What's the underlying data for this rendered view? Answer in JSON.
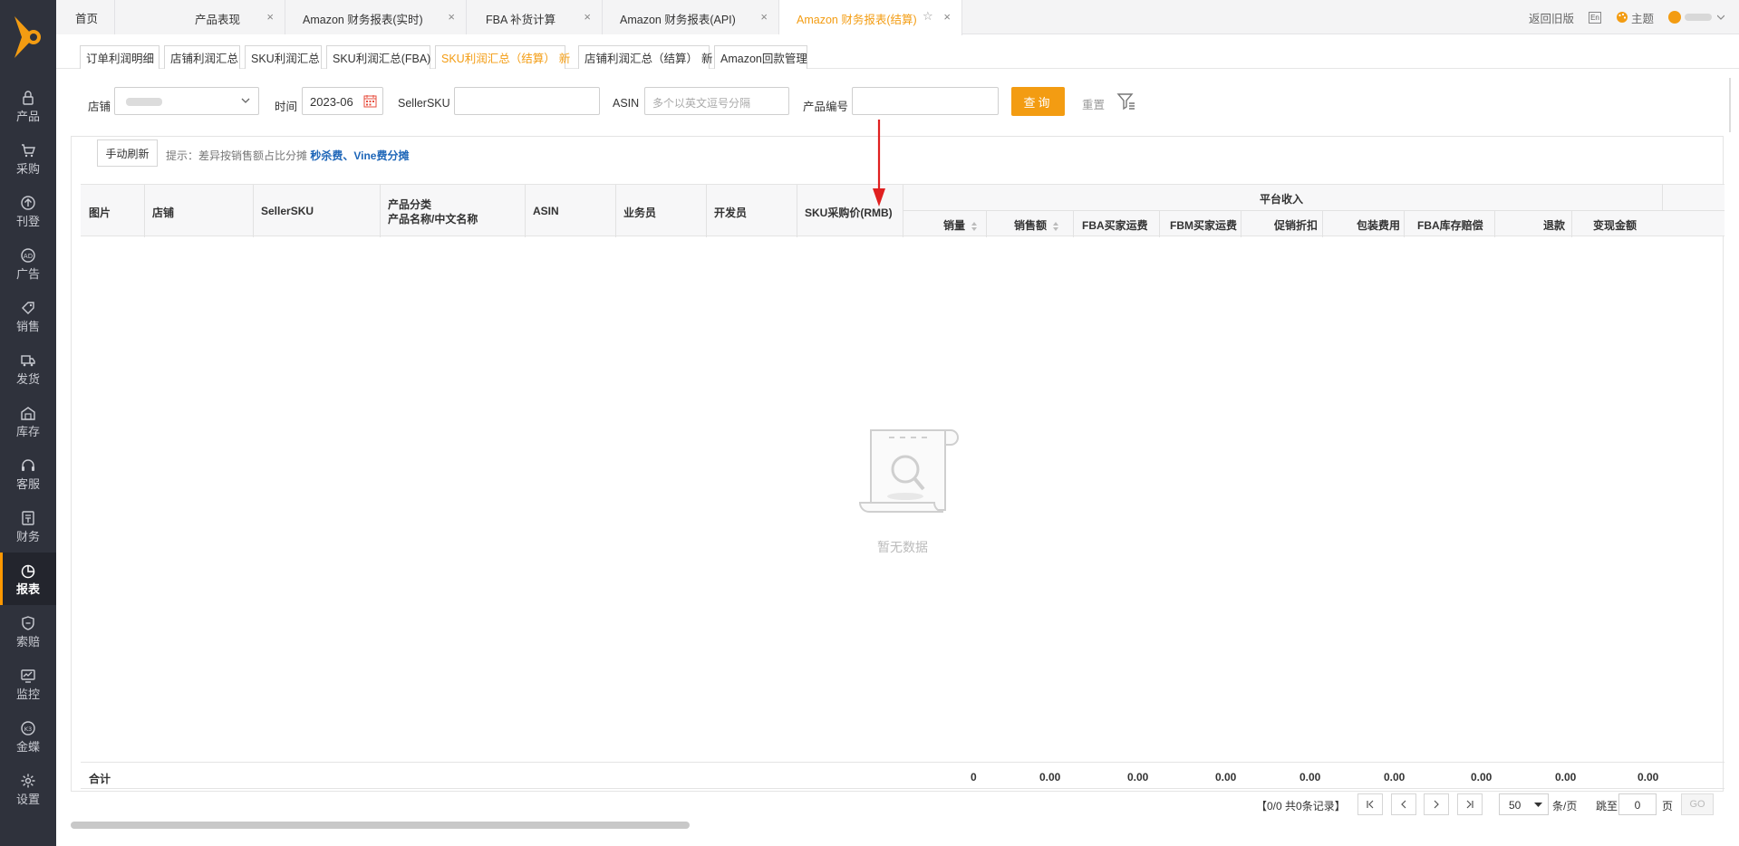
{
  "sidebar": {
    "items": [
      {
        "label": "产品",
        "icon": "lock-icon"
      },
      {
        "label": "采购",
        "icon": "cart-icon"
      },
      {
        "label": "刊登",
        "icon": "upload-icon"
      },
      {
        "label": "广告",
        "icon": "ad-icon"
      },
      {
        "label": "销售",
        "icon": "tag-icon"
      },
      {
        "label": "发货",
        "icon": "truck-icon"
      },
      {
        "label": "库存",
        "icon": "warehouse-icon"
      },
      {
        "label": "客服",
        "icon": "headset-icon"
      },
      {
        "label": "财务",
        "icon": "wallet-icon"
      },
      {
        "label": "报表",
        "icon": "pie-chart-icon"
      },
      {
        "label": "索赔",
        "icon": "shield-icon"
      },
      {
        "label": "监控",
        "icon": "monitor-icon"
      },
      {
        "label": "金蝶",
        "icon": "kingdee-icon"
      },
      {
        "label": "设置",
        "icon": "gear-icon"
      }
    ],
    "active_index": 9
  },
  "top_tabs": [
    {
      "label": "首页",
      "closable": false
    },
    {
      "label": "产品表现",
      "closable": true
    },
    {
      "label": "Amazon 财务报表(实时)",
      "closable": true
    },
    {
      "label": "FBA 补货计算",
      "closable": true
    },
    {
      "label": "Amazon 财务报表(API)",
      "closable": true
    },
    {
      "label": "Amazon 财务报表(结算)",
      "closable": true,
      "active": true
    }
  ],
  "top_right": {
    "old_version": "返回旧版",
    "lang": "En",
    "theme": "主题"
  },
  "sub_tabs": [
    {
      "label": "订单利润明细"
    },
    {
      "label": "店铺利润汇总"
    },
    {
      "label": "SKU利润汇总"
    },
    {
      "label": "SKU利润汇总(FBA)"
    },
    {
      "label": "SKU利润汇总（结算）",
      "badge": "新",
      "active": true
    },
    {
      "label": "店铺利润汇总（结算）",
      "badge": "新"
    },
    {
      "label": "Amazon回款管理"
    }
  ],
  "filters": {
    "store_label": "店铺",
    "time_label": "时间",
    "time_value": "2023-06",
    "sellersku_label": "SellerSKU",
    "asin_label": "ASIN",
    "asin_placeholder": "多个以英文逗号分隔",
    "product_no_label": "产品编号",
    "query_button": "查询",
    "reset_button": "重置"
  },
  "toolbar": {
    "refresh_button": "手动刷新",
    "tip_prefix": "提示：差异按销售额占比分摊",
    "tip_highlight": "秒杀费、Vine费分摊"
  },
  "table": {
    "columns": {
      "image": "图片",
      "store": "店铺",
      "sellersku": "SellerSKU",
      "category_line1": "产品分类",
      "category_line2": "产品名称/中文名称",
      "asin": "ASIN",
      "salesperson": "业务员",
      "developer": "开发员",
      "purchase_price": "SKU采购价(RMB)",
      "platform_income": "平台收入",
      "sales_qty": "销量",
      "sales_amount": "销售额",
      "fba_buyer_shipping": "FBA买家运费",
      "fbm_buyer_shipping": "FBM买家运费",
      "promo_discount": "促销折扣",
      "packaging_fee": "包装费用",
      "fba_inventory_comp": "FBA库存赔偿",
      "refund": "退款",
      "liquidation": "变现金额"
    },
    "empty_text": "暂无数据",
    "footer": {
      "label": "合计",
      "sales_qty": "0",
      "sales_amount": "0.00",
      "fba_buyer_shipping": "0.00",
      "fbm_buyer_shipping": "0.00",
      "promo_discount": "0.00",
      "packaging_fee": "0.00",
      "fba_inventory_comp": "0.00",
      "refund": "0.00",
      "liquidation": "0.00"
    }
  },
  "pagination": {
    "info": "【0/0   共0条记录】",
    "page_size": "50",
    "per_page_label": "条/页",
    "jump_label": "跳至",
    "jump_value": "0",
    "page_label": "页",
    "go_button": "GO"
  },
  "colors": {
    "accent": "#f39c12",
    "sidebar_bg": "#2f323c",
    "link_blue": "#1e66b8",
    "annotation_red": "#e02020"
  }
}
